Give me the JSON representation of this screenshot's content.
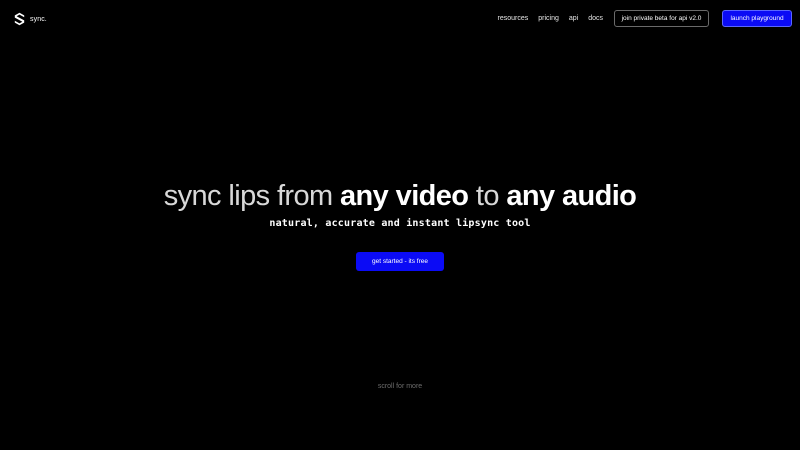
{
  "header": {
    "logo": {
      "text": "sync.",
      "icon": "sync-logo-icon"
    },
    "nav": [
      {
        "label": "resources"
      },
      {
        "label": "pricing"
      },
      {
        "label": "api"
      },
      {
        "label": "docs"
      }
    ],
    "beta_button_label": "join private beta for api v2.0",
    "launch_button_label": "launch playground"
  },
  "hero": {
    "title_part1": "sync lips from ",
    "title_part2": "any video",
    "title_part3": " to ",
    "title_part4": "any audio",
    "subtitle": "natural, accurate and instant lipsync tool",
    "cta_label": "get started - its free"
  },
  "footer": {
    "scroll_hint": "scroll for more"
  },
  "colors": {
    "background": "#000000",
    "accent": "#0b0bf5",
    "text": "#ffffff",
    "muted": "#6e6e6e"
  }
}
